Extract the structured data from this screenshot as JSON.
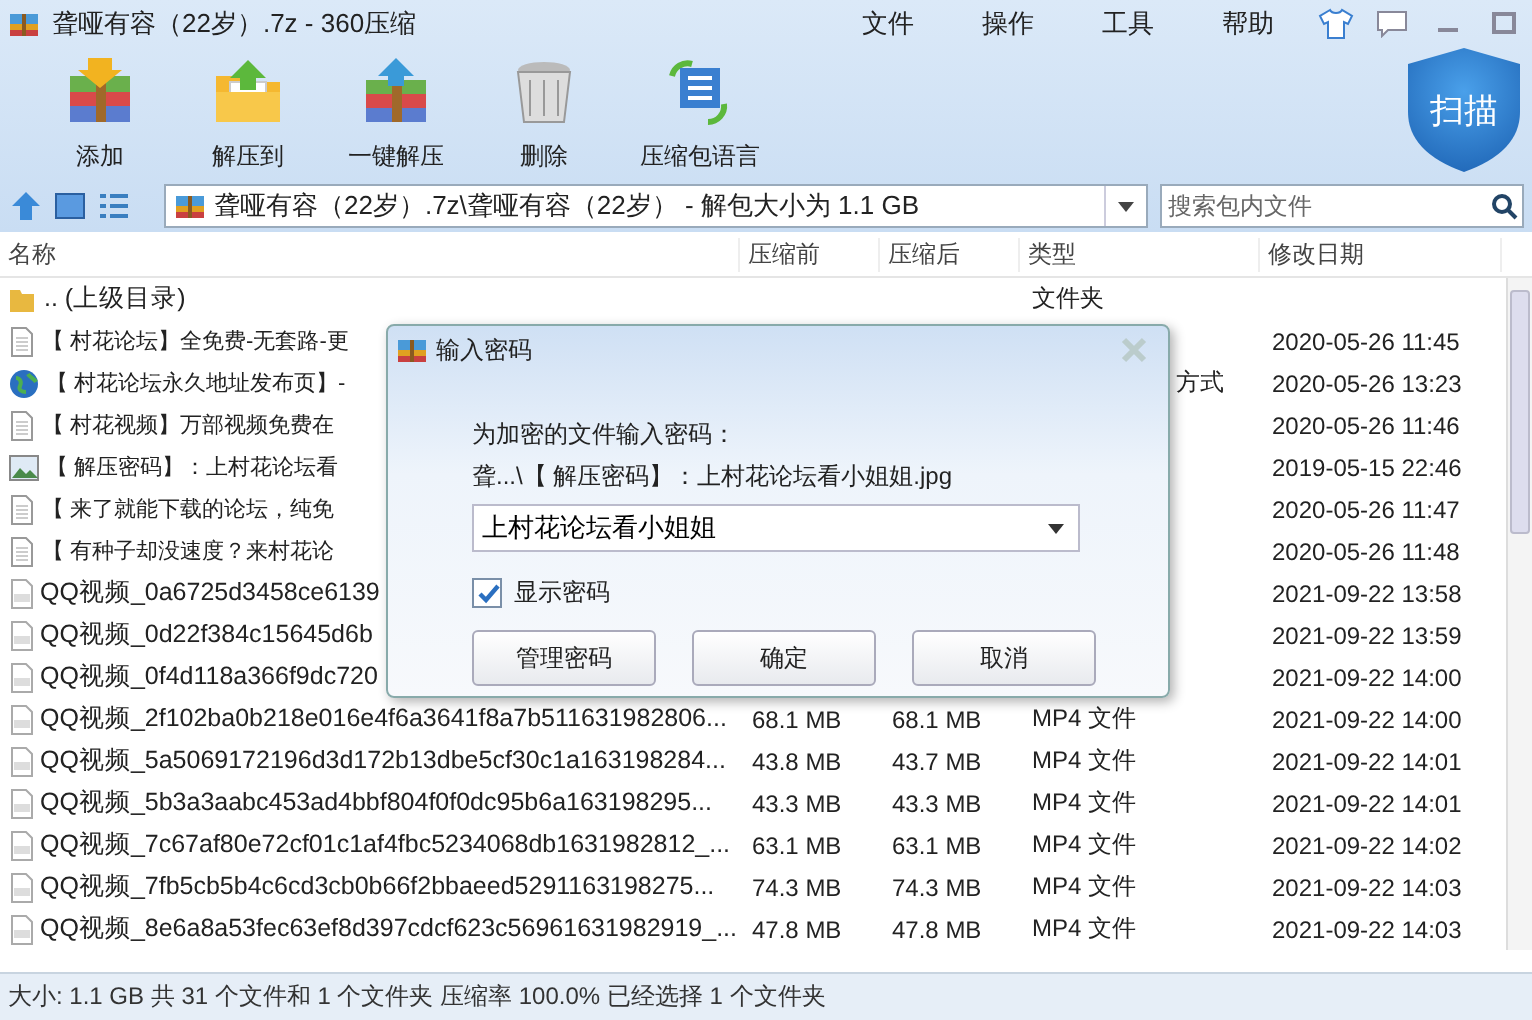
{
  "window": {
    "title": "聋哑有容（22岁）.7z - 360压缩"
  },
  "menu": [
    "文件",
    "操作",
    "工具",
    "帮助"
  ],
  "toolbar": [
    {
      "kind": "add",
      "label": "添加"
    },
    {
      "kind": "extract",
      "label": "解压到"
    },
    {
      "kind": "oneclick",
      "label": "一键解压"
    },
    {
      "kind": "delete",
      "label": "删除"
    },
    {
      "kind": "encoding",
      "label": "压缩包语言"
    }
  ],
  "scan_button": {
    "label": "扫描"
  },
  "address": {
    "path": "聋哑有容（22岁）.7z\\聋哑有容（22岁） - 解包大小为 1.1 GB"
  },
  "search": {
    "placeholder": "搜索包内文件"
  },
  "table": {
    "columns": [
      "名称",
      "压缩前",
      "压缩后",
      "类型",
      "修改日期"
    ],
    "rows": [
      {
        "kind": "folder",
        "name": ".. (上级目录)",
        "type": "文件夹"
      },
      {
        "kind": "text",
        "name": "【 村花论坛】全免费-无套路-更",
        "date": "2020-05-26 11:45"
      },
      {
        "kind": "web",
        "name": "【 村花论坛永久地址发布页】-",
        "type": "方式",
        "date": "2020-05-26 13:23"
      },
      {
        "kind": "text",
        "name": "【 村花视频】万部视频免费在",
        "date": "2020-05-26 11:46"
      },
      {
        "kind": "image",
        "name": "【 解压密码】：上村花论坛看",
        "date": "2019-05-15 22:46"
      },
      {
        "kind": "text",
        "name": "【 来了就能下载的论坛，纯免",
        "date": "2020-05-26 11:47"
      },
      {
        "kind": "text",
        "name": "【 有种子却没速度？来村花论",
        "date": "2020-05-26 11:48"
      },
      {
        "kind": "video",
        "name": "QQ视频_0a6725d3458ce6139",
        "date": "2021-09-22 13:58"
      },
      {
        "kind": "video",
        "name": "QQ视频_0d22f384c15645d6b",
        "date": "2021-09-22 13:59"
      },
      {
        "kind": "video",
        "name": "QQ视频_0f4d118a366f9dc720",
        "date": "2021-09-22 14:00"
      },
      {
        "kind": "video",
        "name": "QQ视频_2f102ba0b218e016e4f6a3641f8a7b511631982806...",
        "before": "68.1 MB",
        "after": "68.1 MB",
        "type": "MP4 文件",
        "date": "2021-09-22 14:00"
      },
      {
        "kind": "video",
        "name": "QQ视频_5a5069172196d3d172b13dbe5cf30c1a163198284...",
        "before": "43.8 MB",
        "after": "43.7 MB",
        "type": "MP4 文件",
        "date": "2021-09-22 14:01"
      },
      {
        "kind": "video",
        "name": "QQ视频_5b3a3aabc453ad4bbf804f0f0dc95b6a163198295...",
        "before": "43.3 MB",
        "after": "43.3 MB",
        "type": "MP4 文件",
        "date": "2021-09-22 14:01"
      },
      {
        "kind": "video",
        "name": "QQ视频_7c67af80e72cf01c1af4fbc5234068db1631982812_...",
        "before": "63.1 MB",
        "after": "63.1 MB",
        "type": "MP4 文件",
        "date": "2021-09-22 14:02"
      },
      {
        "kind": "video",
        "name": "QQ视频_7fb5cb5b4c6cd3cb0b66f2bbaeed5291163198275...",
        "before": "74.3 MB",
        "after": "74.3 MB",
        "type": "MP4 文件",
        "date": "2021-09-22 14:03"
      },
      {
        "kind": "video",
        "name": "QQ视频_8e6a8a53fec63ef8d397cdcf623c56961631982919_...",
        "before": "47.8 MB",
        "after": "47.8 MB",
        "type": "MP4 文件",
        "date": "2021-09-22 14:03"
      }
    ]
  },
  "status_bar": "大小: 1.1 GB 共 31 个文件和 1 个文件夹 压缩率 100.0% 已经选择 1 个文件夹",
  "dialog": {
    "title": "输入密码",
    "prompt": "为加密的文件输入密码：",
    "file": "聋...\\【 解压密码】：上村花论坛看小姐姐.jpg",
    "password": "上村花论坛看小姐姐",
    "show_password": {
      "label": "显示密码",
      "checked": true
    },
    "buttons": [
      "管理密码",
      "确定",
      "取消"
    ]
  }
}
